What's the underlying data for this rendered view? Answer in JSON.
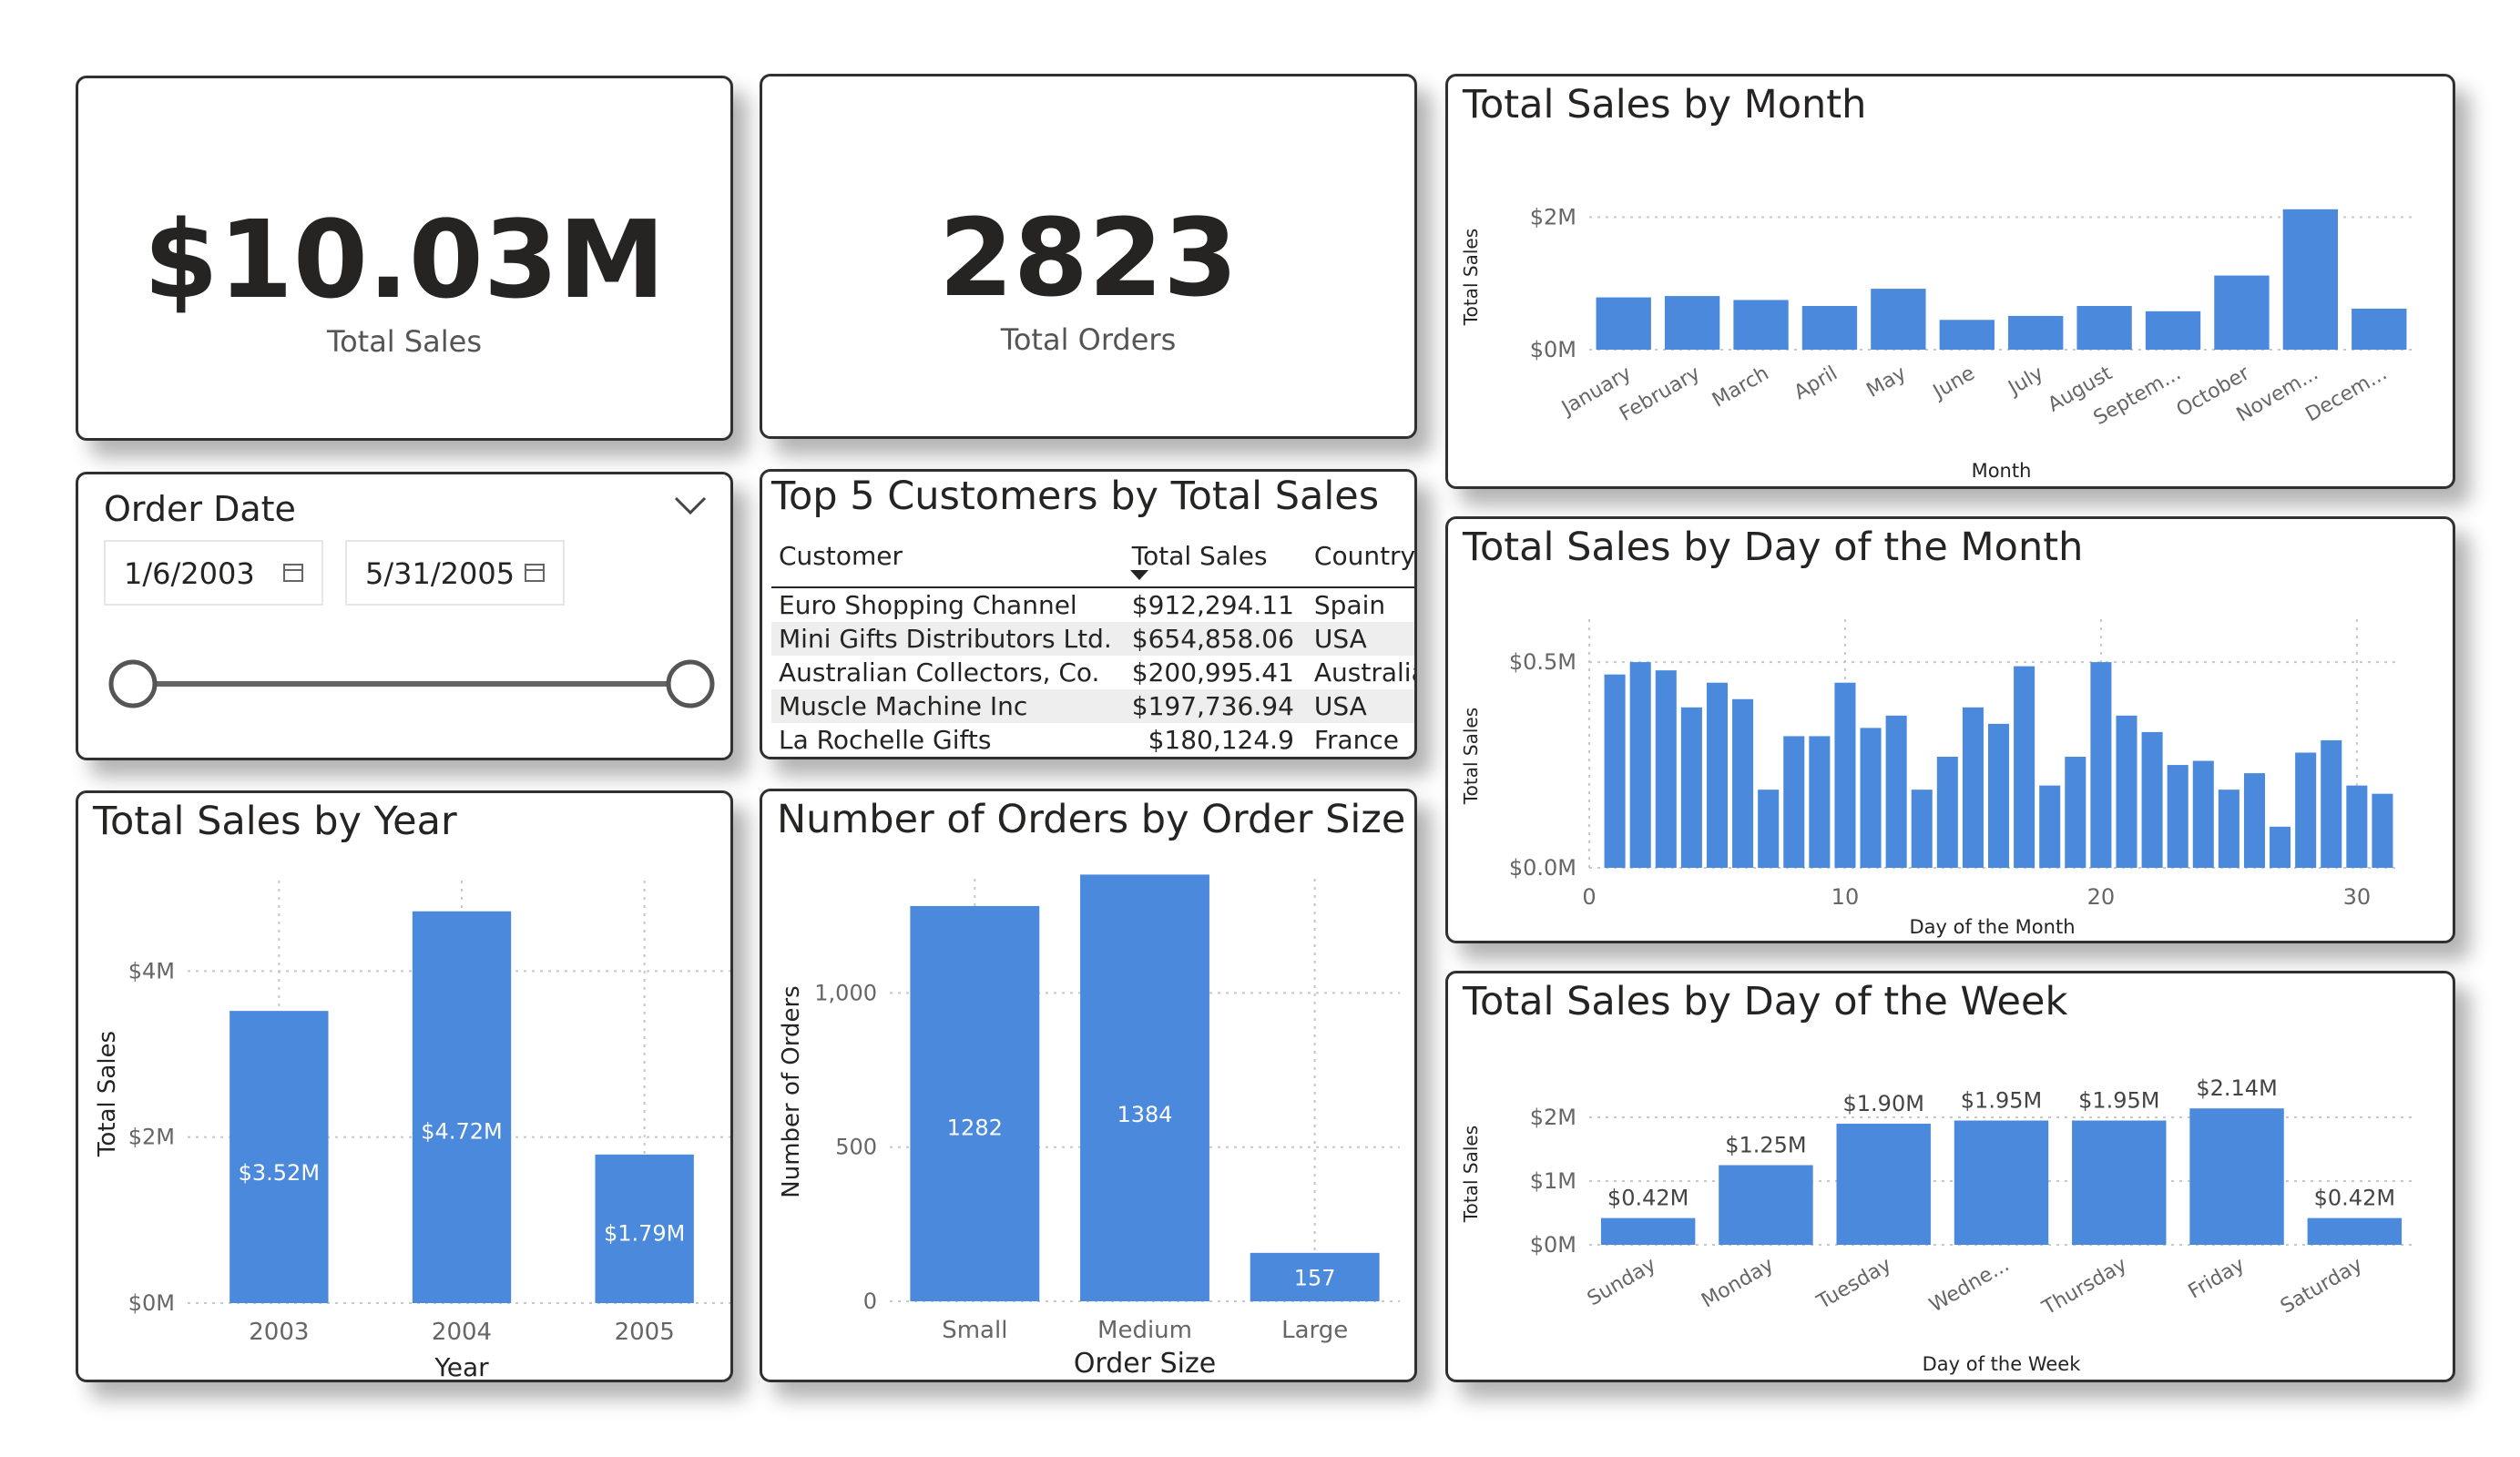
{
  "kpis": {
    "sales": {
      "value": "$10.03M",
      "label": "Total Sales"
    },
    "orders": {
      "value": "2823",
      "label": "Total Orders"
    }
  },
  "filter": {
    "title": "Order Date",
    "start": "1/6/2003",
    "end": "5/31/2005",
    "range_fraction": [
      0,
      1
    ]
  },
  "top_customers": {
    "title": "Top 5 Customers by Total Sales",
    "columns": [
      "Customer",
      "Total Sales",
      "Country"
    ],
    "rows": [
      [
        "Euro Shopping Channel",
        "$912,294.11",
        "Spain"
      ],
      [
        "Mini Gifts Distributors Ltd.",
        "$654,858.06",
        "USA"
      ],
      [
        "Australian Collectors, Co.",
        "$200,995.41",
        "Australia"
      ],
      [
        "Muscle Machine Inc",
        "$197,736.94",
        "USA"
      ],
      [
        "La Rochelle Gifts",
        "$180,124.9",
        "France"
      ]
    ]
  },
  "colors": {
    "bar": "#4a89dc",
    "grid": "#c8c8c8",
    "text": "#252423",
    "axis_text": "#666666"
  },
  "chart_data": [
    {
      "id": "month",
      "type": "bar",
      "title": "Total Sales by Month",
      "xlabel": "Month",
      "ylabel": "Total Sales",
      "categories": [
        "January",
        "February",
        "March",
        "April",
        "May",
        "June",
        "July",
        "August",
        "Septem...",
        "October",
        "Novem...",
        "Decem..."
      ],
      "values": [
        0.79,
        0.81,
        0.75,
        0.66,
        0.92,
        0.45,
        0.51,
        0.66,
        0.58,
        1.12,
        2.12,
        0.62
      ],
      "yticks": [
        "$0M",
        "$2M"
      ],
      "ytick_values": [
        0,
        2
      ],
      "ylim": [
        0,
        2.2
      ],
      "grid": true
    },
    {
      "id": "dom",
      "type": "bar",
      "title": "Total Sales by Day of the Month",
      "xlabel": "Day of the Month",
      "ylabel": "Total Sales",
      "x": [
        1,
        2,
        3,
        4,
        5,
        6,
        7,
        8,
        9,
        10,
        11,
        12,
        13,
        14,
        15,
        16,
        17,
        18,
        19,
        20,
        21,
        22,
        23,
        24,
        25,
        26,
        27,
        28,
        29,
        30,
        31
      ],
      "values": [
        0.47,
        0.5,
        0.48,
        0.39,
        0.45,
        0.41,
        0.19,
        0.32,
        0.32,
        0.45,
        0.34,
        0.37,
        0.19,
        0.27,
        0.39,
        0.35,
        0.49,
        0.2,
        0.27,
        0.5,
        0.37,
        0.33,
        0.25,
        0.26,
        0.19,
        0.23,
        0.1,
        0.28,
        0.31,
        0.2,
        0.18
      ],
      "xticks": [
        0,
        10,
        20,
        30
      ],
      "yticks": [
        "$0.0M",
        "$0.5M"
      ],
      "ytick_values": [
        0,
        0.5
      ],
      "xlim": [
        0,
        31.5
      ],
      "ylim": [
        0,
        0.56
      ],
      "grid": true
    },
    {
      "id": "dow",
      "type": "bar",
      "title": "Total Sales by Day of the Week",
      "xlabel": "Day of the Week",
      "ylabel": "Total Sales",
      "categories": [
        "Sunday",
        "Monday",
        "Tuesday",
        "Wedne...",
        "Thursday",
        "Friday",
        "Saturday"
      ],
      "values": [
        0.42,
        1.25,
        1.9,
        1.95,
        1.95,
        2.14,
        0.42
      ],
      "labels": [
        "$0.42M",
        "$1.25M",
        "$1.90M",
        "$1.95M",
        "$1.95M",
        "$2.14M",
        "$0.42M"
      ],
      "yticks": [
        "$0M",
        "$1M",
        "$2M"
      ],
      "ytick_values": [
        0,
        1,
        2
      ],
      "ylim": [
        0,
        2.4
      ],
      "grid": true
    },
    {
      "id": "year",
      "type": "bar",
      "title": "Total Sales by Year",
      "xlabel": "Year",
      "ylabel": "Total Sales",
      "categories": [
        "2003",
        "2004",
        "2005"
      ],
      "values": [
        3.52,
        4.72,
        1.79
      ],
      "labels": [
        "$3.52M",
        "$4.72M",
        "$1.79M"
      ],
      "yticks": [
        "$0M",
        "$2M",
        "$4M"
      ],
      "ytick_values": [
        0,
        2,
        4
      ],
      "ylim": [
        0,
        5.2
      ],
      "grid": true
    },
    {
      "id": "size",
      "type": "bar",
      "title": "Number of Orders by Order Size",
      "xlabel": "Order Size",
      "ylabel": "Number of Orders",
      "categories": [
        "Small",
        "Medium",
        "Large"
      ],
      "values": [
        1282,
        1384,
        157
      ],
      "labels": [
        "1282",
        "1384",
        "157"
      ],
      "yticks": [
        "0",
        "500",
        "1,000"
      ],
      "ytick_values": [
        0,
        500,
        1000
      ],
      "ylim": [
        0,
        1400
      ],
      "grid": true
    }
  ]
}
